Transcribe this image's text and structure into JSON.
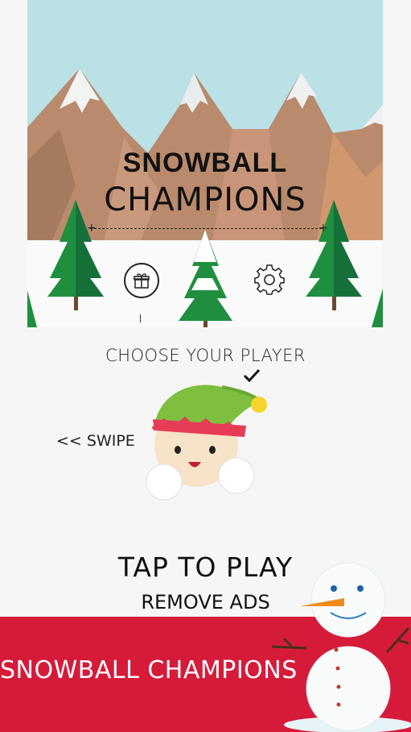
{
  "game": {
    "title_line1": "SNOWBALL",
    "title_line2": "CHAMPIONS",
    "choose_player": "CHOOSE YOUR PLAYER",
    "swipe_hint": "<< SWIPE",
    "tap_to_play": "TAP TO PLAY",
    "remove_ads": "REMOVE ADS"
  },
  "icons": {
    "gift": "gift-icon",
    "settings": "gear-icon",
    "selected": "check-icon"
  },
  "banner": {
    "text": "SNOWBALL CHAMPIONS"
  },
  "colors": {
    "sky": "#b9e1e6",
    "mountain": "#b98a6c",
    "tree": "#1f8f3f",
    "banner": "#d61b3a",
    "background": "#f6f6f6"
  }
}
